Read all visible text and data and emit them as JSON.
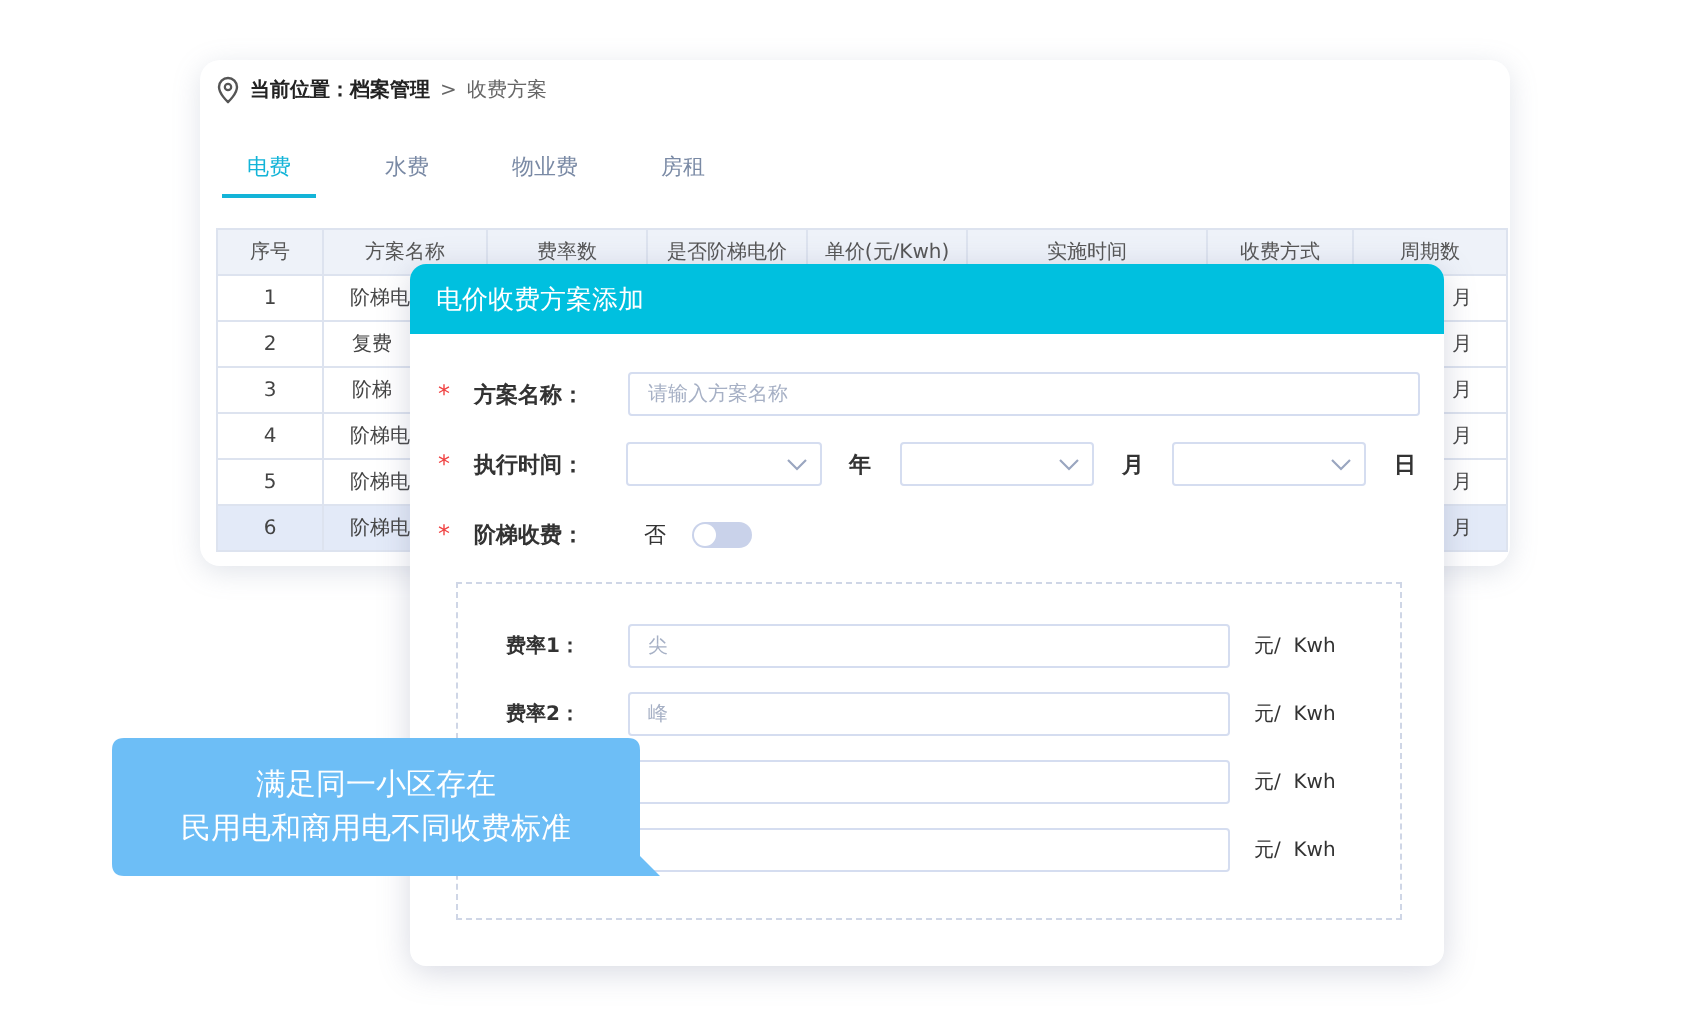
{
  "breadcrumb": {
    "prefix": "当前位置：",
    "items": [
      "档案管理",
      "收费方案"
    ],
    "separator": ">"
  },
  "tabs": [
    {
      "label": "电费",
      "selected": true
    },
    {
      "label": "水费",
      "selected": false
    },
    {
      "label": "物业费",
      "selected": false
    },
    {
      "label": "房租",
      "selected": false
    }
  ],
  "table": {
    "columns": [
      "序号",
      "方案名称",
      "费率数",
      "是否阶梯电价",
      "单价(元/Kwh)",
      "实施时间",
      "收费方式",
      "周期数"
    ],
    "rows": [
      {
        "cells": [
          "1",
          "阶梯电",
          "月"
        ],
        "selected": false
      },
      {
        "cells": [
          "2",
          "复费",
          "月"
        ],
        "selected": false
      },
      {
        "cells": [
          "3",
          "阶梯",
          "月"
        ],
        "selected": false
      },
      {
        "cells": [
          "4",
          "阶梯电",
          "月"
        ],
        "selected": false
      },
      {
        "cells": [
          "5",
          "阶梯电",
          "月"
        ],
        "selected": false
      },
      {
        "cells": [
          "6",
          "阶梯电",
          "月"
        ],
        "selected": true
      }
    ]
  },
  "dialog": {
    "title": "电价收费方案添加",
    "fields": [
      {
        "kind": "text",
        "label": "方案名称：",
        "required_mark": "*",
        "placeholder": "请输入方案名称"
      },
      {
        "kind": "date",
        "label": "执行时间：",
        "required_mark": "*",
        "units": [
          "年",
          "月",
          "日"
        ]
      },
      {
        "kind": "switch",
        "label": "阶梯收费：",
        "required_mark": "*",
        "value_text": "否",
        "on": false
      }
    ],
    "rates": [
      {
        "label": "费率1：",
        "placeholder": "尖",
        "unit": "元/  Kwh"
      },
      {
        "label": "费率2：",
        "placeholder": "峰",
        "unit": "元/  Kwh"
      },
      {
        "unit": "元/  Kwh"
      },
      {
        "unit": "元/  Kwh"
      }
    ]
  },
  "callout": {
    "lines": [
      "满足同一小区存在",
      "民用电和商用电不同收费标准"
    ]
  }
}
